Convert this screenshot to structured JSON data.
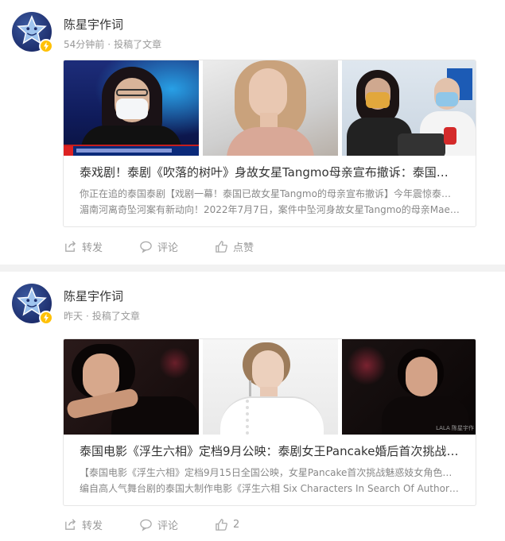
{
  "posts": [
    {
      "author": "陈星宇作词",
      "time": "54分钟前",
      "action_text": "投稿了文章",
      "card": {
        "title": "泰戏剧！泰剧《吹落的树叶》身故女星Tangmo母亲宣布撤诉：泰国已故女星Tangmo的母亲宣布撤诉",
        "desc_line1": "你正在追的泰国泰剧【戏剧一幕！泰国已故女星Tangmo的母亲宣布撤诉】今年震惊泰国的",
        "desc_line2": "湄南河离奇坠河案有新动向！2022年7月7日，案件中坠河身故女星Tangmo的母亲Mae Panida宣布撤诉"
      },
      "buttons": {
        "repost": "转发",
        "comment": "评论",
        "like": "点赞"
      }
    },
    {
      "author": "陈星宇作词",
      "time": "昨天",
      "action_text": "投稿了文章",
      "card": {
        "title": "泰国电影《浮生六相》定档9月公映：泰剧女王Pancake婚后首次挑战魅惑妓女角色",
        "desc_line1": "【泰国电影《浮生六相》定档9月15日全国公映，女星Pancake首次挑战魅惑妓女角色】改",
        "desc_line2": "编自高人气舞台剧的泰国大制作电影《浮生六相 Six Characters In Search Of Author》即将上映"
      },
      "buttons": {
        "repost": "转发",
        "comment": "评论",
        "like": "2"
      }
    }
  ],
  "watermark": "LALA 陈星宇作",
  "colors": {
    "muted": "#999999",
    "text": "#333333",
    "border": "#e6e6e6",
    "divider": "#f2f2f2",
    "badge": "#ffc107"
  },
  "icons": [
    "star-avatar-icon",
    "verified-badge-icon",
    "repost-icon",
    "comment-icon",
    "like-icon"
  ]
}
